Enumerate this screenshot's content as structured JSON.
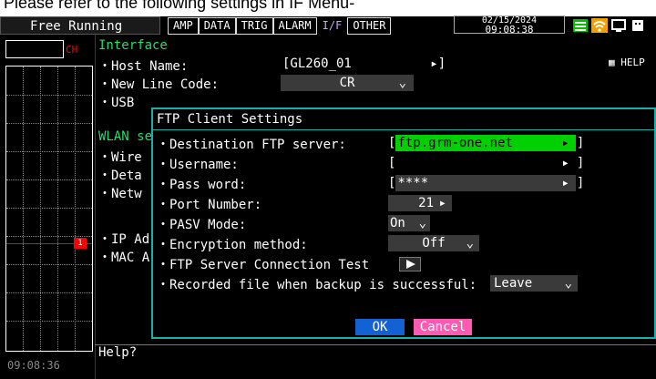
{
  "caption": {
    "text": "Please refer to the following settings in IF Menu-"
  },
  "topbar": {
    "mode": "Free Running",
    "tabs": [
      "AMP",
      "DATA",
      "TRIG",
      "ALARM",
      "I/F",
      "OTHER"
    ],
    "active_tab_index": 4,
    "date": "02/15/2024",
    "time": "09:08:38",
    "icons": [
      "menu-icon",
      "wifi-icon",
      "network-icon",
      "usb-icon"
    ]
  },
  "left_panel": {
    "channel_label": "CH",
    "time": "09:08:36",
    "marker_value": "1"
  },
  "interface": {
    "section_title": "Interface",
    "host_name_label": "・Host Name:",
    "host_name_value": "[GL260_01",
    "host_name_close": "]",
    "new_line_code_label": "・New Line Code:",
    "new_line_code_value": "CR",
    "usb_label": "・USB",
    "help_chip": "HELP"
  },
  "wlan": {
    "section_title": "WLAN se",
    "items": [
      "・Wire",
      "・Deta",
      "・Netw",
      "・IP Ad",
      "・MAC A"
    ]
  },
  "dialog": {
    "title": "FTP Client Settings",
    "rows": [
      {
        "label": "・Destination FTP server:",
        "value": "ftp.grm-one.net"
      },
      {
        "label": "・Username:",
        "value": ""
      },
      {
        "label": "・Pass word:",
        "value": "****"
      },
      {
        "label": "・Port Number:",
        "value": "21"
      },
      {
        "label": "・PASV Mode:",
        "value": "On"
      },
      {
        "label": "・Encryption method:",
        "value": "Off"
      },
      {
        "label": "・FTP Server Connection Test",
        "value": ""
      },
      {
        "label": "・Recorded file when backup is successful:",
        "value": "Leave"
      }
    ],
    "ok": "OK",
    "cancel": "Cancel"
  },
  "help": {
    "text": "Help?"
  }
}
